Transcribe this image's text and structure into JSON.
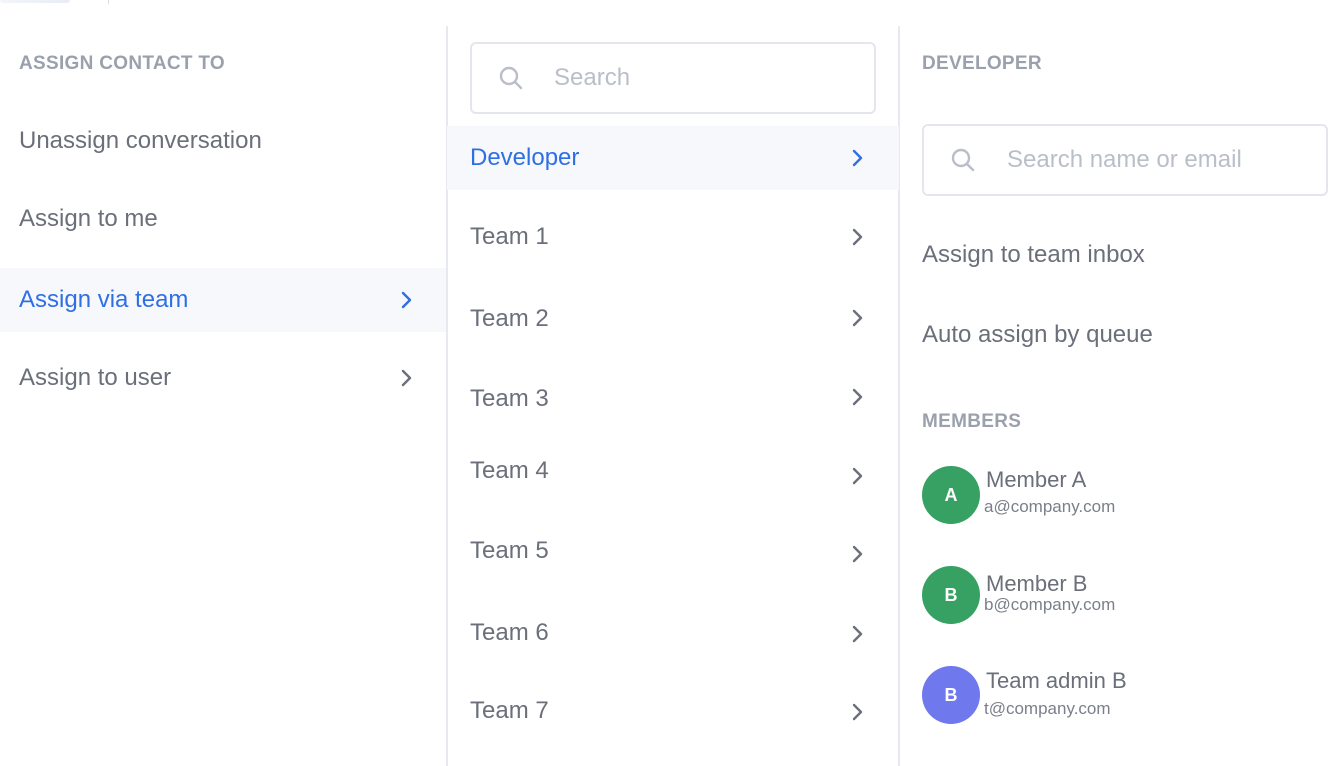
{
  "left_panel": {
    "header": "ASSIGN CONTACT TO",
    "items": [
      {
        "label": "Unassign conversation",
        "has_chevron": false,
        "active": false
      },
      {
        "label": "Assign to me",
        "has_chevron": false,
        "active": false
      },
      {
        "label": "Assign via team",
        "has_chevron": true,
        "active": true
      },
      {
        "label": "Assign to user",
        "has_chevron": true,
        "active": false
      }
    ]
  },
  "team_panel": {
    "search": {
      "placeholder": "Search",
      "value": "",
      "icon": "search-icon"
    },
    "teams": [
      {
        "label": "Developer",
        "active": true
      },
      {
        "label": "Team 1",
        "active": false
      },
      {
        "label": "Team 2",
        "active": false
      },
      {
        "label": "Team 3",
        "active": false
      },
      {
        "label": "Team 4",
        "active": false
      },
      {
        "label": "Team 5",
        "active": false
      },
      {
        "label": "Team 6",
        "active": false
      },
      {
        "label": "Team 7",
        "active": false
      }
    ]
  },
  "detail_panel": {
    "header": "DEVELOPER",
    "search": {
      "placeholder": "Search name or email",
      "value": "",
      "icon": "search-icon"
    },
    "actions": [
      {
        "label": "Assign to team inbox"
      },
      {
        "label": "Auto assign by queue"
      }
    ],
    "members_header": "MEMBERS",
    "members": [
      {
        "initial": "A",
        "name": "Member A",
        "email": "a@company.com",
        "color": "#37a164"
      },
      {
        "initial": "B",
        "name": "Member B",
        "email": "b@company.com",
        "color": "#37a164"
      },
      {
        "initial": "B",
        "name": "Team admin B",
        "email": "t@company.com",
        "color": "#6f78ec"
      }
    ]
  },
  "colors": {
    "accent": "#2f6fe4",
    "text": "#6b6f7a",
    "header": "#9aa1ad",
    "active_bg": "#f6f8fc",
    "border": "#e3e6ec"
  }
}
